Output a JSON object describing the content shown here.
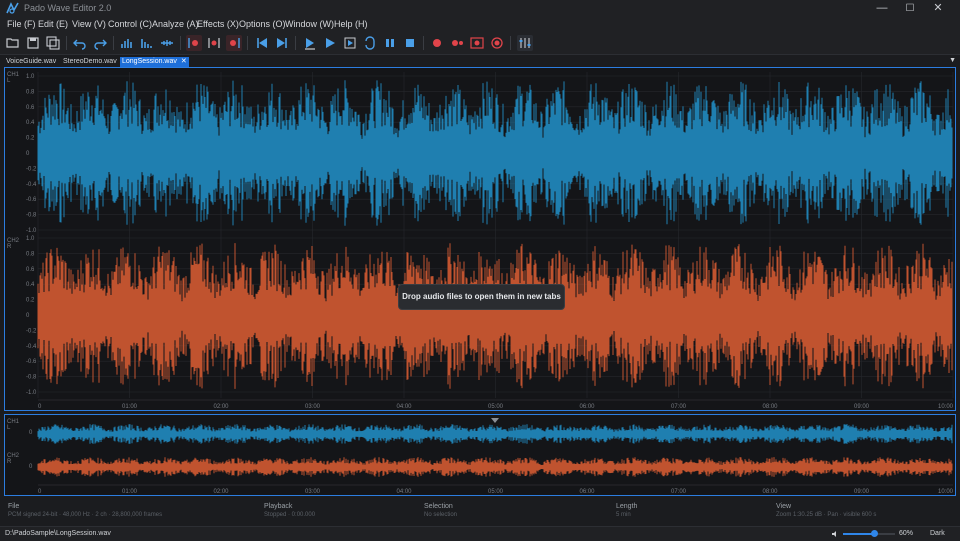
{
  "window": {
    "title": "Pado Wave Editor 2.0",
    "minimize": "—",
    "maximize": "☐",
    "close": "✕"
  },
  "menu": [
    "File (F)",
    "Edit (E)",
    "View (V)",
    "Control (C)",
    "Analyze (A)",
    "Effects (X)",
    "Options (O)",
    "Window (W)",
    "Help (H)"
  ],
  "toolbar": {
    "buttons": [
      {
        "name": "open-file-icon"
      },
      {
        "name": "save-icon"
      },
      {
        "name": "save-all-icon"
      },
      {
        "name": "undo-icon"
      },
      {
        "name": "redo-icon"
      },
      {
        "name": "bars-icon"
      },
      {
        "name": "spectrum-icon"
      },
      {
        "name": "fit-icon"
      },
      {
        "name": "marker-left-icon"
      },
      {
        "name": "marker-center-icon"
      },
      {
        "name": "marker-right-icon"
      },
      {
        "name": "skip-start-icon"
      },
      {
        "name": "skip-end-icon"
      },
      {
        "name": "play-selection-icon"
      },
      {
        "name": "play-icon"
      },
      {
        "name": "play-from-cursor-icon"
      },
      {
        "name": "loop-icon"
      },
      {
        "name": "pause-icon"
      },
      {
        "name": "stop-icon"
      },
      {
        "name": "record-icon"
      },
      {
        "name": "record-append-icon"
      },
      {
        "name": "record-punch-icon"
      },
      {
        "name": "record-monitor-icon"
      },
      {
        "name": "mixer-icon"
      }
    ]
  },
  "tabs": [
    {
      "label": "VoiceGuide.wav",
      "active": false
    },
    {
      "label": "StereoDemo.wav",
      "active": false
    },
    {
      "label": "LongSession.wav",
      "active": true
    }
  ],
  "tab_dropdown": "▼",
  "main_view": {
    "ch1_label": "CH1",
    "ch1_sub": "L",
    "ch2_label": "CH2",
    "ch2_sub": "R",
    "y_ticks": [
      "1.0",
      "0.8",
      "0.6",
      "0.4",
      "0.2",
      "0",
      "-0.2",
      "-0.4",
      "-0.6",
      "-0.8",
      "-1.0"
    ],
    "time_ticks": [
      "0",
      "01:00",
      "02:00",
      "03:00",
      "04:00",
      "05:00",
      "06:00",
      "07:00",
      "08:00",
      "09:00",
      "10:00"
    ],
    "drop_hint": "Drop audio files to open them in new tabs",
    "colors": {
      "ch1": "#1f7fb0",
      "ch2": "#c0532f",
      "grid": "#26282d"
    }
  },
  "overview": {
    "ch1_label": "CH1",
    "ch1_sub": "L",
    "ch2_label": "CH2",
    "ch2_sub": "R",
    "zero_label": "0",
    "time_ticks": [
      "0",
      "01:00",
      "02:00",
      "03:00",
      "04:00",
      "05:00",
      "06:00",
      "07:00",
      "08:00",
      "09:00",
      "10:00"
    ]
  },
  "status": {
    "file": {
      "header": "File",
      "value": "PCM signed 24-bit · 48,000 Hz · 2 ch · 28,800,000 frames"
    },
    "playback": {
      "header": "Playback",
      "value": "Stopped · 0:00.000"
    },
    "selection": {
      "header": "Selection",
      "value": "No selection"
    },
    "length": {
      "header": "Length",
      "value": "5 min"
    },
    "view": {
      "header": "View",
      "value": "Zoom 1:30.25 dB · Pan · visible 600 s"
    }
  },
  "bottom": {
    "path": "D:\\PadoSample\\LongSession.wav",
    "volume_pct": "60%",
    "volume_level": 0.6,
    "theme": "Dark"
  }
}
